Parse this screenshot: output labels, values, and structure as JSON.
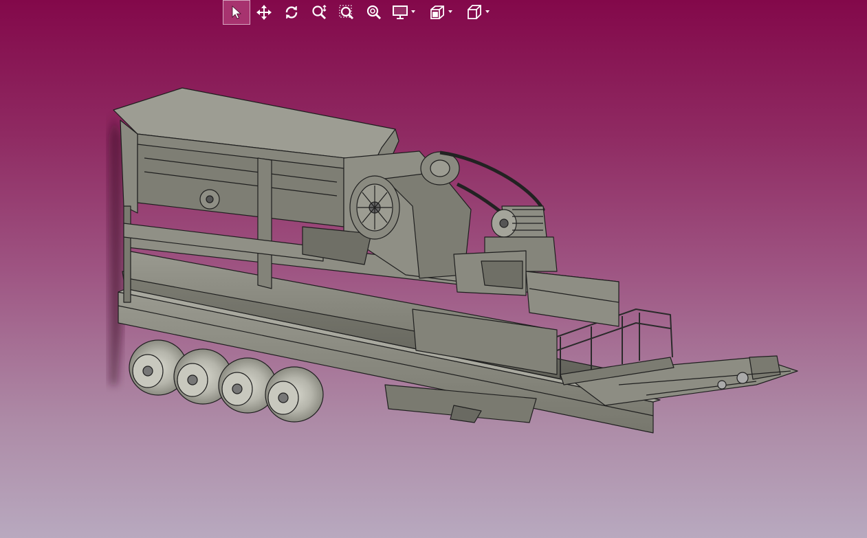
{
  "toolbar": {
    "buttons": [
      {
        "id": "select",
        "icon": "select-arrow-icon",
        "active": true
      },
      {
        "id": "pan",
        "icon": "move-arrows-icon"
      },
      {
        "id": "rotate",
        "icon": "rotate-icon"
      },
      {
        "id": "zoom-dynamic",
        "icon": "zoom-dynamic-icon"
      },
      {
        "id": "zoom-area",
        "icon": "zoom-area-icon"
      },
      {
        "id": "zoom-fit",
        "icon": "zoom-fit-icon"
      },
      {
        "id": "display-mode",
        "icon": "monitor-icon",
        "dropdown": true
      },
      {
        "id": "section-view",
        "icon": "section-cube-icon",
        "dropdown": true
      },
      {
        "id": "view-orientation",
        "icon": "view-cube-icon",
        "dropdown": true
      }
    ]
  },
  "colors": {
    "background_top": "#83084a",
    "background_bottom": "#b8a9bf",
    "model_fill": "#8a8a80",
    "model_edge": "#1e1e1e",
    "toolbar_icon": "#ffffff"
  },
  "viewport": {
    "model": "mobile-jaw-crusher-trailer"
  }
}
